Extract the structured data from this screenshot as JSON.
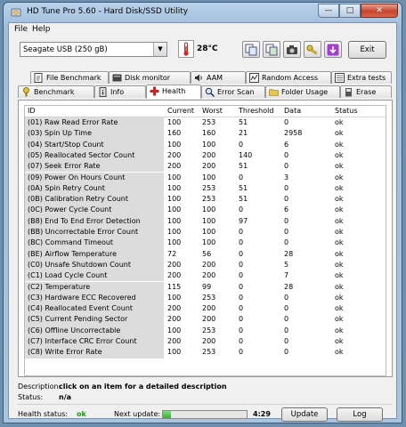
{
  "window": {
    "title": "HD Tune Pro 5.60 - Hard Disk/SSD Utility",
    "minimize": "—",
    "maximize": "□",
    "close": "✕"
  },
  "menu": [
    {
      "label": "File"
    },
    {
      "label": "Help"
    }
  ],
  "toolbar": {
    "drive": "Seagate USB (250 gB)",
    "temperature": "28°C",
    "exit_label": "Exit"
  },
  "tabs_row1": [
    {
      "label": "File Benchmark",
      "icon": "file-benchmark-icon"
    },
    {
      "label": "Disk monitor",
      "icon": "disk-monitor-icon"
    },
    {
      "label": "AAM",
      "icon": "aam-icon"
    },
    {
      "label": "Random Access",
      "icon": "random-access-icon"
    },
    {
      "label": "Extra tests",
      "icon": "extra-tests-icon"
    }
  ],
  "tabs_row2": [
    {
      "label": "Benchmark",
      "icon": "benchmark-icon"
    },
    {
      "label": "Info",
      "icon": "info-icon"
    },
    {
      "label": "Health",
      "icon": "health-icon",
      "active": true
    },
    {
      "label": "Error Scan",
      "icon": "error-scan-icon"
    },
    {
      "label": "Folder Usage",
      "icon": "folder-icon"
    },
    {
      "label": "Erase",
      "icon": "erase-icon"
    }
  ],
  "table": {
    "columns": [
      "ID",
      "Current",
      "Worst",
      "Threshold",
      "Data",
      "Status"
    ],
    "rows": [
      [
        "(01) Raw Read Error Rate",
        "100",
        "253",
        "51",
        "0",
        "ok"
      ],
      [
        "(03) Spin Up Time",
        "160",
        "160",
        "21",
        "2958",
        "ok"
      ],
      [
        "(04) Start/Stop Count",
        "100",
        "100",
        "0",
        "6",
        "ok"
      ],
      [
        "(05) Reallocated Sector Count",
        "200",
        "200",
        "140",
        "0",
        "ok"
      ],
      [
        "(07) Seek Error Rate",
        "200",
        "200",
        "51",
        "0",
        "ok"
      ],
      [
        "(09) Power On Hours Count",
        "100",
        "100",
        "0",
        "3",
        "ok"
      ],
      [
        "(0A) Spin Retry Count",
        "100",
        "253",
        "51",
        "0",
        "ok"
      ],
      [
        "(0B) Calibration Retry Count",
        "100",
        "253",
        "51",
        "0",
        "ok"
      ],
      [
        "(0C) Power Cycle Count",
        "100",
        "100",
        "0",
        "6",
        "ok"
      ],
      [
        "(B8) End To End Error Detection",
        "100",
        "100",
        "97",
        "0",
        "ok"
      ],
      [
        "(BB) Uncorrectable Error Count",
        "100",
        "100",
        "0",
        "0",
        "ok"
      ],
      [
        "(BC) Command Timeout",
        "100",
        "100",
        "0",
        "0",
        "ok"
      ],
      [
        "(BE) Airflow Temperature",
        "72",
        "56",
        "0",
        "28",
        "ok"
      ],
      [
        "(C0) Unsafe Shutdown Count",
        "200",
        "200",
        "0",
        "5",
        "ok"
      ],
      [
        "(C1) Load Cycle Count",
        "200",
        "200",
        "0",
        "7",
        "ok"
      ],
      [
        "(C2) Temperature",
        "115",
        "99",
        "0",
        "28",
        "ok"
      ],
      [
        "(C3) Hardware ECC Recovered",
        "100",
        "253",
        "0",
        "0",
        "ok"
      ],
      [
        "(C4) Reallocated Event Count",
        "200",
        "200",
        "0",
        "0",
        "ok"
      ],
      [
        "(C5) Current Pending Sector",
        "200",
        "200",
        "0",
        "0",
        "ok"
      ],
      [
        "(C6) Offline Uncorrectable",
        "100",
        "253",
        "0",
        "0",
        "ok"
      ],
      [
        "(C7) Interface CRC Error Count",
        "200",
        "200",
        "0",
        "0",
        "ok"
      ],
      [
        "(C8) Write Error Rate",
        "100",
        "253",
        "0",
        "0",
        "ok"
      ]
    ]
  },
  "description": {
    "label": "Description:",
    "value": "click on an item for a detailed description",
    "status_label": "Status:",
    "status_value": "n/a"
  },
  "statusbar": {
    "health_label": "Health status:",
    "health_value": "ok",
    "next_update_label": "Next update:",
    "progress": 0.1,
    "countdown": "4:29",
    "update_label": "Update",
    "log_label": "Log"
  },
  "colors": {
    "ok_green": "#1a9a1a",
    "accent": "#2fb52a"
  }
}
